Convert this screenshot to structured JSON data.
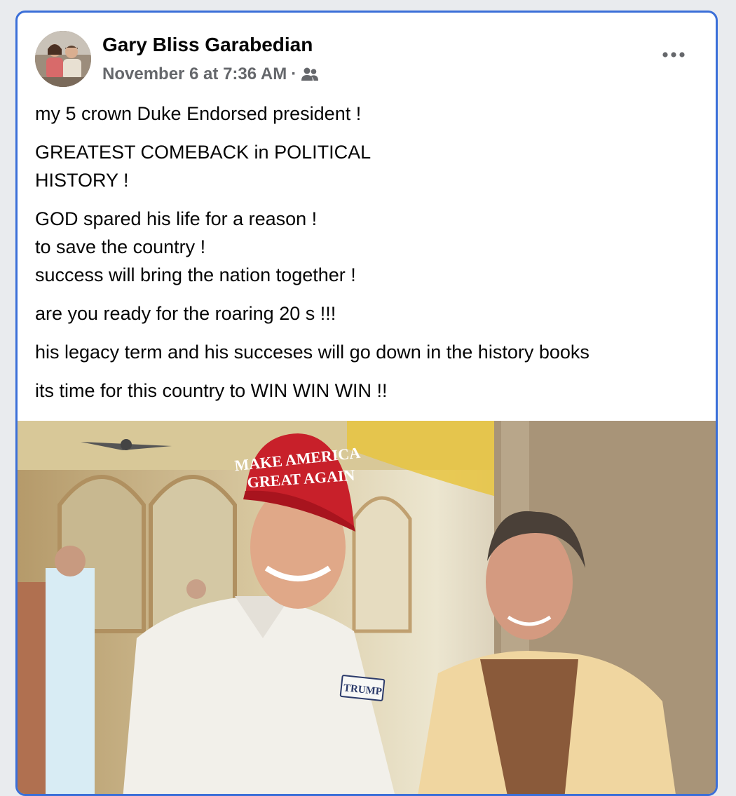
{
  "post": {
    "author": "Gary Bliss Garabedian",
    "timestamp": "November 6 at 7:36 AM",
    "separator": "·",
    "audience_icon": "friends-icon",
    "more_icon": "more-options-icon",
    "paragraphs": [
      "my 5 crown Duke Endorsed president !",
      "GREATEST COMEBACK  in POLITICAL\nHISTORY !",
      "GOD spared his life for a reason !\nto save the country !\nsuccess will bring the nation together !",
      "are you ready for the roaring 20 s !!!",
      "his legacy term and his succeses will go down in the history books",
      "its time for this country to WIN WIN WIN !!"
    ],
    "photo": {
      "hat_line1": "MAKE AMERICA",
      "hat_line2": "GREAT AGAIN",
      "shirt_logo": "TRUMP"
    }
  },
  "colors": {
    "card_border": "#3b6fd8",
    "author_text": "#050505",
    "meta_text": "#65676b",
    "hat_red": "#c8202a"
  }
}
